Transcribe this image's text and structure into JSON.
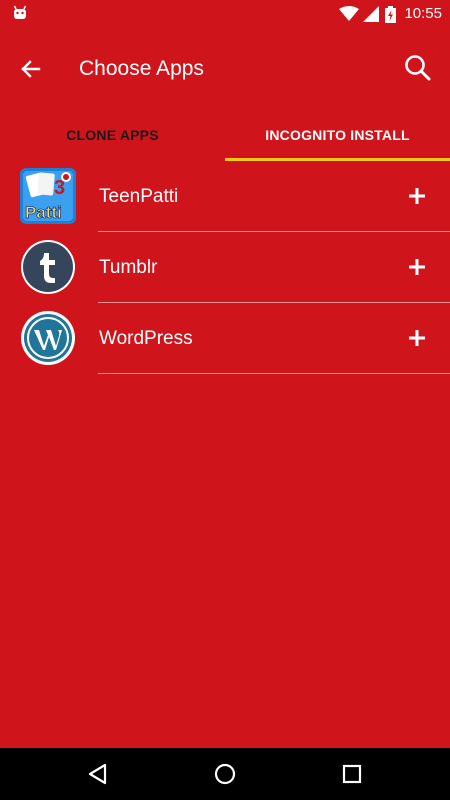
{
  "status_bar": {
    "time": "10:55",
    "icons": [
      "android-icon",
      "wifi-icon",
      "cell-signal-icon",
      "battery-charging-icon"
    ]
  },
  "app_bar": {
    "title": "Choose Apps",
    "back_icon": "arrow-back-icon",
    "search_icon": "search-icon"
  },
  "tabs": [
    {
      "label": "CLONE APPS",
      "selected": false
    },
    {
      "label": "INCOGNITO INSTALL",
      "selected": true
    }
  ],
  "apps": [
    {
      "name": "TeenPatti",
      "icon": "teenpatti-icon",
      "action_icon": "plus-icon"
    },
    {
      "name": "Tumblr",
      "icon": "tumblr-icon",
      "action_icon": "plus-icon"
    },
    {
      "name": "WordPress",
      "icon": "wordpress-icon",
      "action_icon": "plus-icon"
    }
  ],
  "teenpatti_logo_text": "Patti",
  "teenpatti_badge": "3",
  "colors": {
    "background": "#d0141c",
    "tab_indicator": "#f5c518",
    "nav_bar": "#000000",
    "tumblr_blue": "#35465c",
    "wordpress_blue": "#21759b"
  },
  "nav_bar": {
    "buttons": [
      "back-triangle-icon",
      "home-circle-icon",
      "recents-square-icon"
    ]
  }
}
